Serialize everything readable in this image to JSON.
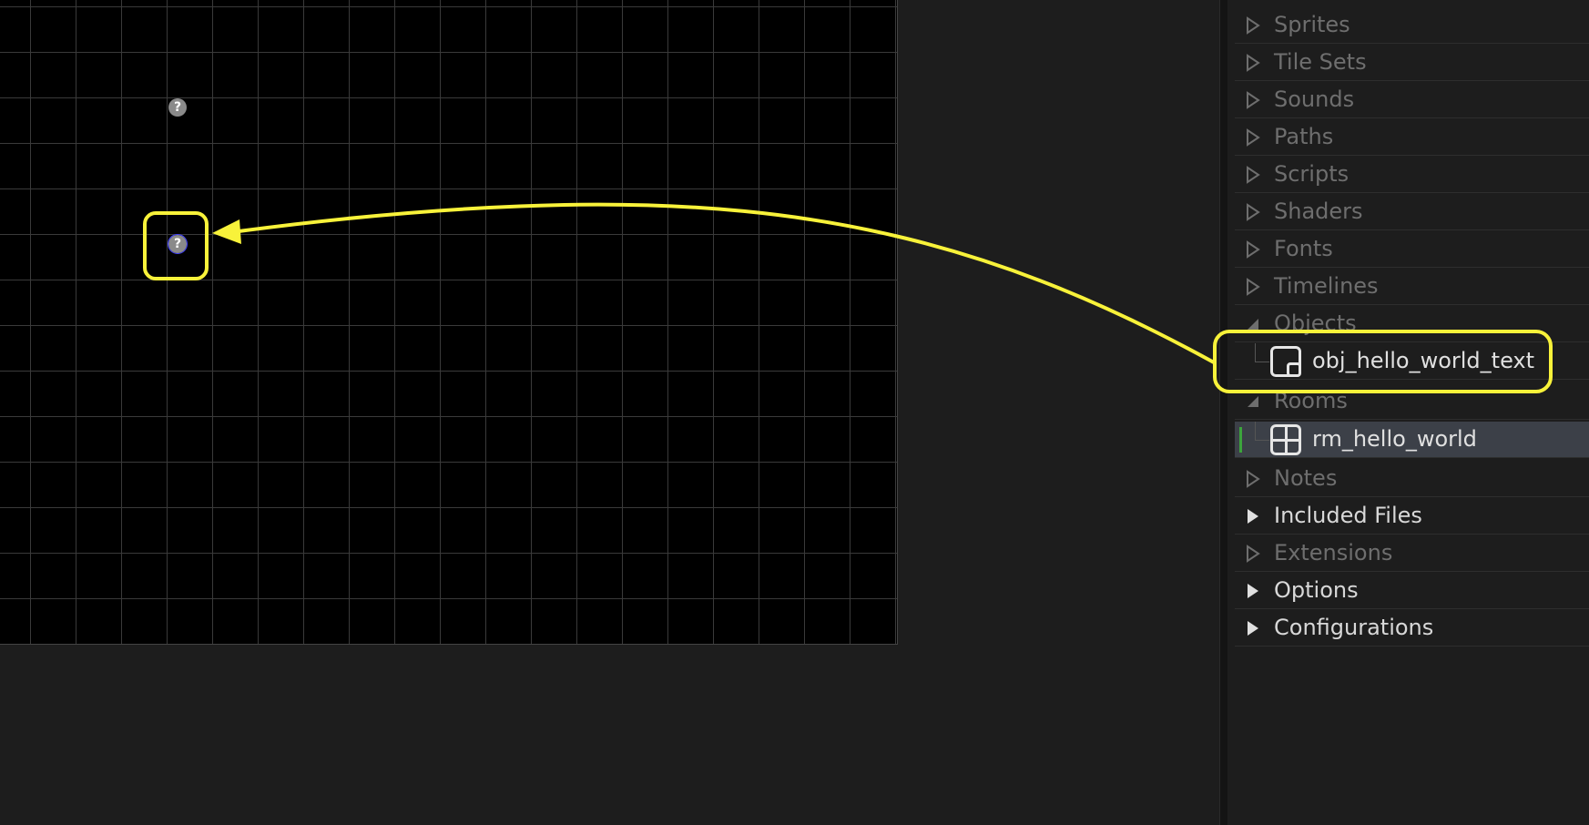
{
  "resource_tree": {
    "items": [
      {
        "label": "Sprites",
        "state": "collapsed",
        "active": false
      },
      {
        "label": "Tile Sets",
        "state": "collapsed",
        "active": false
      },
      {
        "label": "Sounds",
        "state": "collapsed",
        "active": false
      },
      {
        "label": "Paths",
        "state": "collapsed",
        "active": false
      },
      {
        "label": "Scripts",
        "state": "collapsed",
        "active": false
      },
      {
        "label": "Shaders",
        "state": "collapsed",
        "active": false
      },
      {
        "label": "Fonts",
        "state": "collapsed",
        "active": false
      },
      {
        "label": "Timelines",
        "state": "collapsed",
        "active": false
      },
      {
        "label": "Objects",
        "state": "expanded",
        "active": false
      },
      {
        "label": "obj_hello_world_text",
        "type": "object"
      },
      {
        "label": "Rooms",
        "state": "expanded",
        "active": false
      },
      {
        "label": "rm_hello_world",
        "type": "room",
        "selected": true
      },
      {
        "label": "Notes",
        "state": "collapsed",
        "active": false
      },
      {
        "label": "Included Files",
        "state": "collapsed",
        "active": true
      },
      {
        "label": "Extensions",
        "state": "collapsed",
        "active": false
      },
      {
        "label": "Options",
        "state": "collapsed",
        "active": true
      },
      {
        "label": "Configurations",
        "state": "collapsed",
        "active": true
      }
    ]
  },
  "room": {
    "instances": [
      {
        "icon": "question-icon",
        "glyph": "?"
      },
      {
        "icon": "question-icon",
        "glyph": "?",
        "selected": true
      }
    ]
  },
  "colors": {
    "annotation": "#f8f23a",
    "selection_bar": "#3ca43c",
    "selected_row": "#3c4048"
  }
}
